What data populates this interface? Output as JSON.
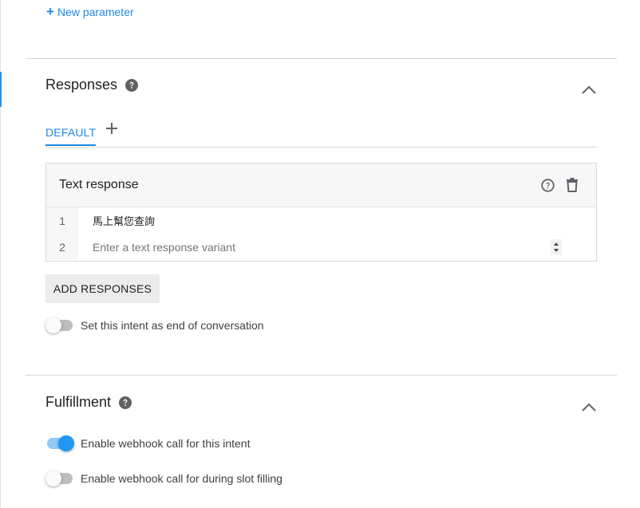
{
  "parameters": {
    "new_parameter_label": "New parameter"
  },
  "responses": {
    "title": "Responses",
    "tabs": [
      {
        "label": "DEFAULT",
        "active": true
      }
    ],
    "text_response": {
      "title": "Text response",
      "rows": [
        {
          "number": "1",
          "text": "馬上幫您查詢"
        },
        {
          "number": "2",
          "placeholder": "Enter a text response variant"
        }
      ]
    },
    "add_responses_label": "ADD RESPONSES",
    "end_conversation": {
      "label": "Set this intent as end of conversation",
      "enabled": false
    }
  },
  "fulfillment": {
    "title": "Fulfillment",
    "webhook_intent": {
      "label": "Enable webhook call for this intent",
      "enabled": true
    },
    "webhook_slot_filling": {
      "label": "Enable webhook call for during slot filling",
      "enabled": false
    }
  },
  "icons": {
    "help": "help-circle-icon",
    "collapse": "chevron-up-icon",
    "add": "plus-icon",
    "delete": "trash-icon",
    "spinner": "spinner-arrows-icon"
  },
  "colors": {
    "accent": "#2196f3",
    "link": "#1e88e5",
    "toggle_track_on": "#90caf9"
  }
}
